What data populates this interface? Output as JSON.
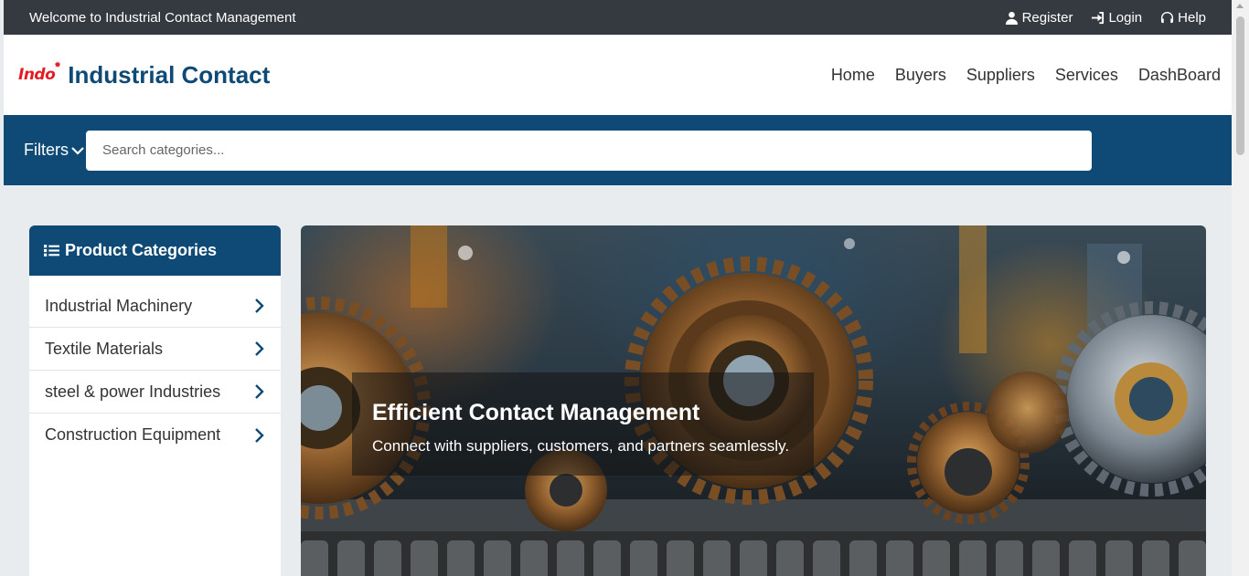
{
  "topbar": {
    "welcome": "Welcome to Industrial Contact Management",
    "links": [
      {
        "label": "Register",
        "icon": "user-icon"
      },
      {
        "label": "Login",
        "icon": "sign-in-icon"
      },
      {
        "label": "Help",
        "icon": "headset-icon"
      }
    ]
  },
  "header": {
    "logo_text": "Indo",
    "title": "Industrial Contact",
    "nav": [
      "Home",
      "Buyers",
      "Suppliers",
      "Services",
      "DashBoard"
    ]
  },
  "filterbar": {
    "filters_label": "Filters",
    "search_placeholder": "Search categories..."
  },
  "sidebar": {
    "heading": "Product Categories",
    "items": [
      "Industrial Machinery",
      "Textile Materials",
      "steel & power Industries",
      "Construction Equipment"
    ]
  },
  "hero": {
    "heading": "Efficient Contact Management",
    "subtext": "Connect with suppliers, customers, and partners seamlessly."
  },
  "colors": {
    "brand": "#0e4a75",
    "topbar": "#343a40",
    "logo": "#e31b23"
  }
}
